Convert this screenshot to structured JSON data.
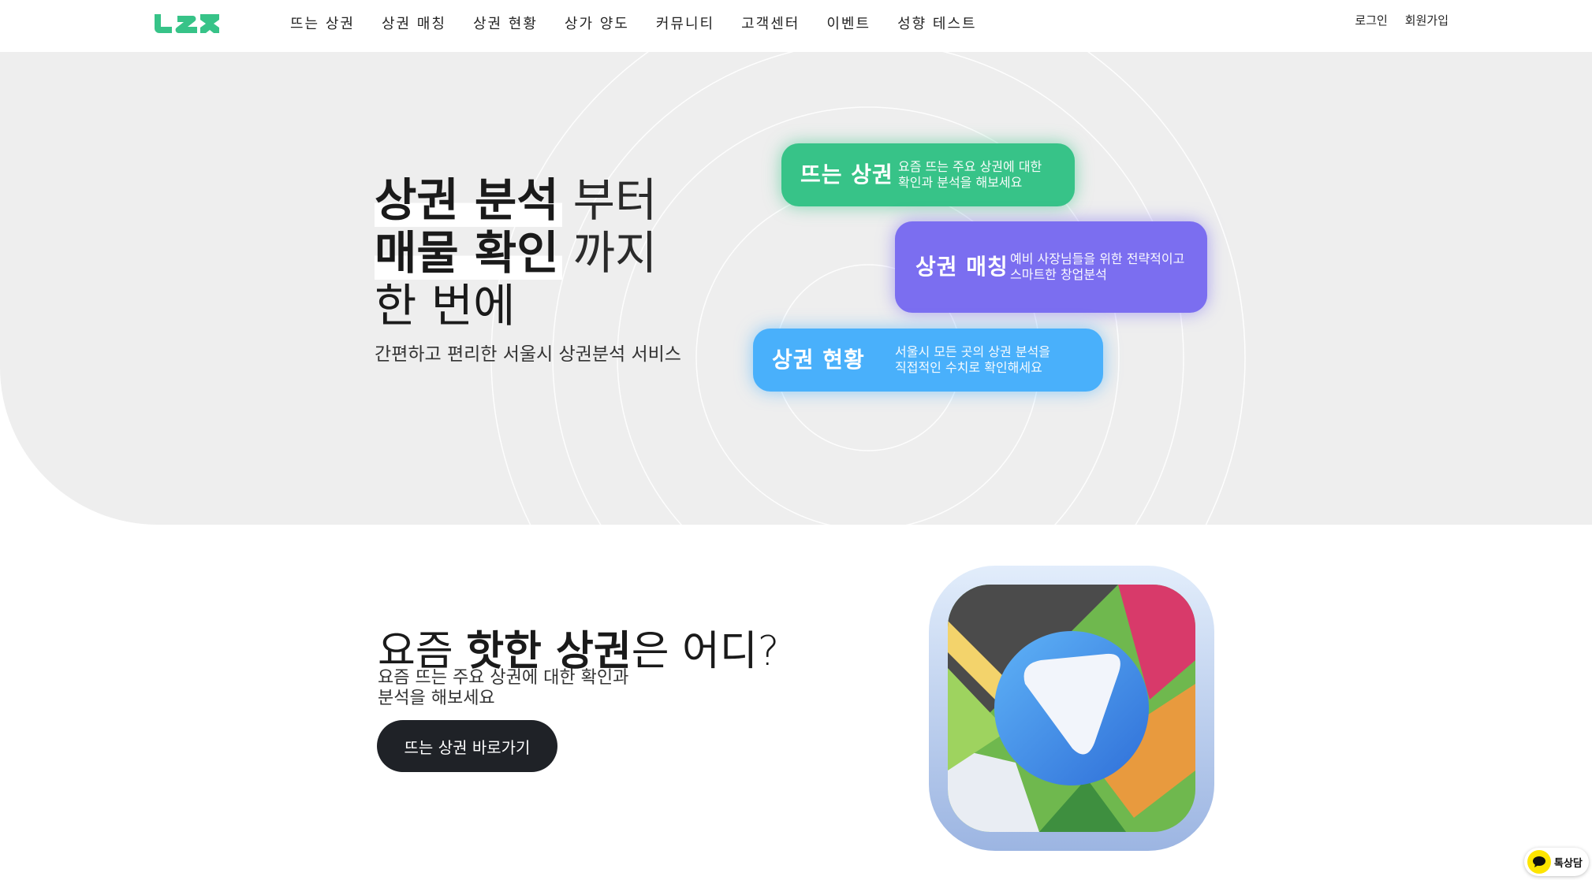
{
  "header": {
    "logo_icon": "lzz-logo",
    "nav": [
      "뜨는 상권",
      "상권 매칭",
      "상권 현황",
      "상가 양도",
      "커뮤니티",
      "고객센터",
      "이벤트",
      "성향 테스트"
    ],
    "login": "로그인",
    "signup": "회원가입"
  },
  "hero": {
    "line1_strong": "상권 분석",
    "line1_light": "부터",
    "line2_strong": "매물 확인",
    "line2_light": "까지",
    "line3": "한 번에",
    "subtitle": "간편하고 편리한 서울시 상권분석 서비스",
    "cards": [
      {
        "title": "뜨는 상권",
        "desc1": "요즘 뜨는 주요 상권에 대한",
        "desc2": "확인과 분석을 해보세요",
        "color": "#37c388"
      },
      {
        "title": "상권 매칭",
        "desc1": "예비 사장님들을 위한 전략적이고",
        "desc2": "스마트한 창업분석",
        "color": "#7b6ef0"
      },
      {
        "title": "상권 현황",
        "desc1": "서울시 모든 곳의 상권 분석을",
        "desc2": "직접적인 수치로 확인해세요",
        "color": "#49b0fb"
      }
    ]
  },
  "section": {
    "title_pre": "요즘 ",
    "title_strong": "핫한 상권",
    "title_post": "은 어디?",
    "desc1": "요즘 뜨는 주요 상권에 대한 확인과",
    "desc2": "분석을 해보세요",
    "button": "뜨는 상권 바로가기",
    "icon": "map-navigation-app-icon"
  },
  "chat": {
    "label": "톡상담",
    "icon": "kakao-chat-icon"
  }
}
